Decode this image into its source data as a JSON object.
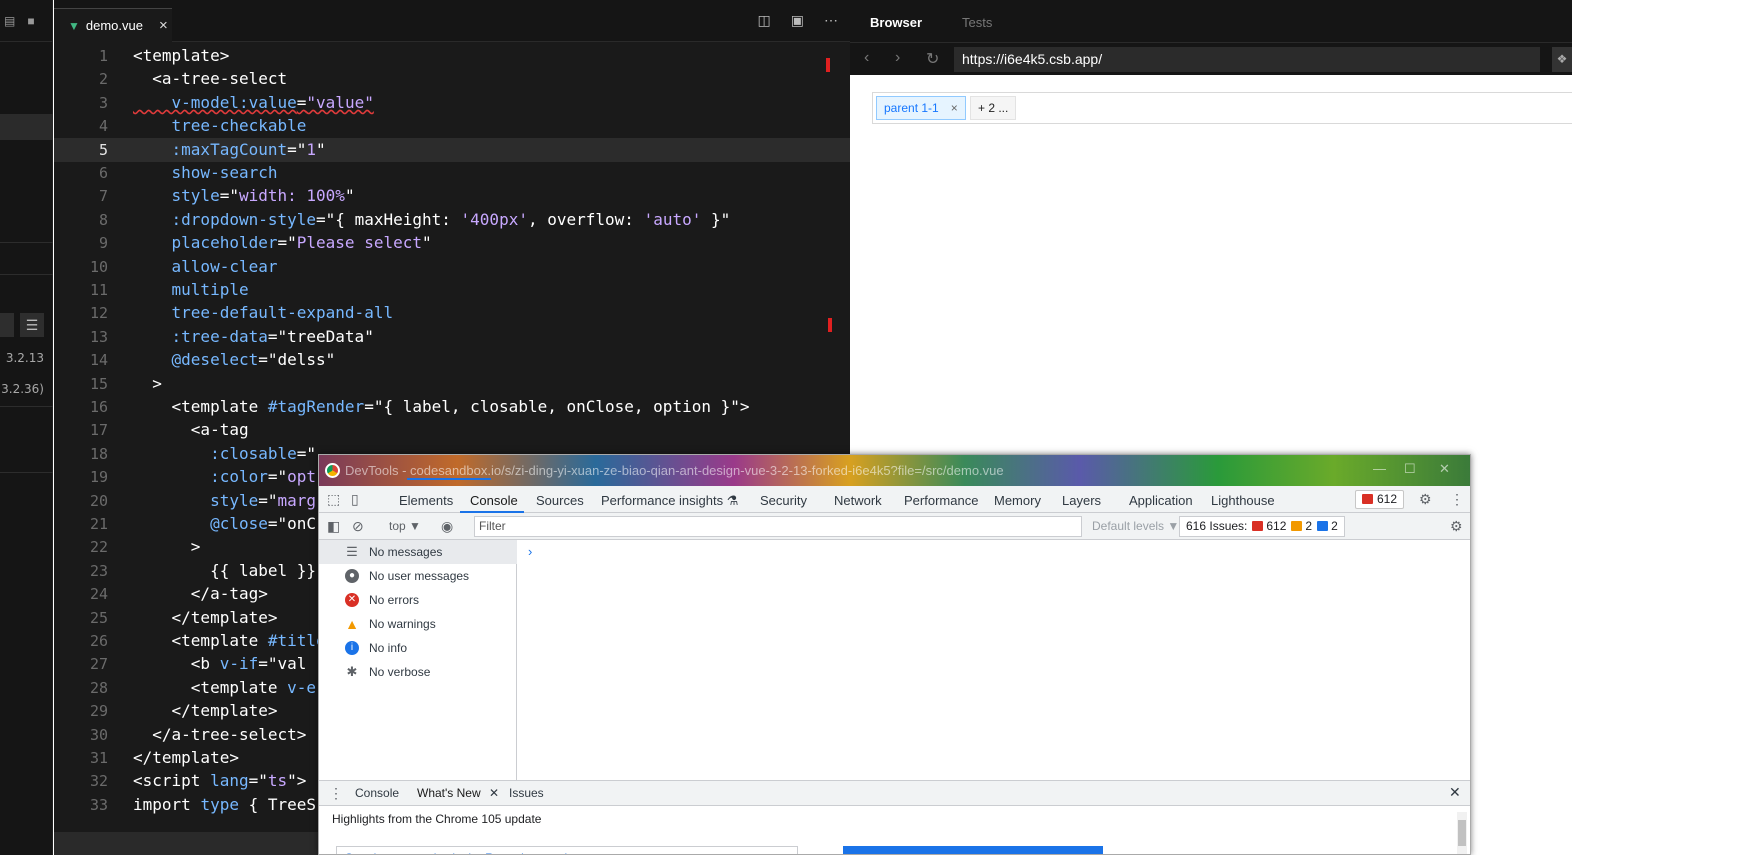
{
  "sidebar": {
    "versions": [
      "3.2.13",
      "3.2.36)"
    ]
  },
  "editor": {
    "tab_label": "demo.vue",
    "tab_close": "×",
    "lines": [
      [
        [
          "t-tag",
          "<template>"
        ]
      ],
      [
        [
          "t-tag",
          "  <a-tree-select"
        ]
      ],
      [
        [
          "t-attr t-err",
          "    v-model:value"
        ],
        [
          "t-tag t-err",
          "="
        ],
        [
          "t-str t-err",
          "\"value\""
        ]
      ],
      [
        [
          "t-attr",
          "    tree-checkable"
        ]
      ],
      [
        [
          "t-attr",
          "    :maxTagCount"
        ],
        [
          "t-tag",
          "=\""
        ],
        [
          "t-str",
          "1"
        ],
        [
          "t-tag",
          "\""
        ]
      ],
      [
        [
          "t-attr",
          "    show-search"
        ]
      ],
      [
        [
          "t-attr",
          "    style"
        ],
        [
          "t-tag",
          "=\""
        ],
        [
          "t-str",
          "width: 100%"
        ],
        [
          "t-tag",
          "\""
        ]
      ],
      [
        [
          "t-attr",
          "    :dropdown-style"
        ],
        [
          "t-tag",
          "=\"{ maxHeight: "
        ],
        [
          "t-str",
          "'400px'"
        ],
        [
          "t-tag",
          ", overflow: "
        ],
        [
          "t-str",
          "'auto'"
        ],
        [
          "t-tag",
          " }\""
        ]
      ],
      [
        [
          "t-attr",
          "    placeholder"
        ],
        [
          "t-tag",
          "=\""
        ],
        [
          "t-str",
          "Please select"
        ],
        [
          "t-tag",
          "\""
        ]
      ],
      [
        [
          "t-attr",
          "    allow-clear"
        ]
      ],
      [
        [
          "t-attr",
          "    multiple"
        ]
      ],
      [
        [
          "t-attr",
          "    tree-default-expand-all"
        ]
      ],
      [
        [
          "t-attr",
          "    :tree-data"
        ],
        [
          "t-tag",
          "=\"treeData\""
        ]
      ],
      [
        [
          "t-attr",
          "    @deselect"
        ],
        [
          "t-tag",
          "=\"delss\""
        ]
      ],
      [
        [
          "t-tag",
          "  >"
        ]
      ],
      [
        [
          "t-tag",
          "    <template "
        ],
        [
          "t-attr",
          "#tagRender"
        ],
        [
          "t-tag",
          "=\"{ label, closable, onClose, option }\">"
        ]
      ],
      [
        [
          "t-tag",
          "      <a-tag"
        ]
      ],
      [
        [
          "t-attr",
          "        :closable"
        ],
        [
          "t-tag",
          "=\""
        ]
      ],
      [
        [
          "t-attr",
          "        :color"
        ],
        [
          "t-tag",
          "=\""
        ],
        [
          "t-str",
          "opt"
        ]
      ],
      [
        [
          "t-attr",
          "        style"
        ],
        [
          "t-tag",
          "=\""
        ],
        [
          "t-str",
          "marg"
        ]
      ],
      [
        [
          "t-attr",
          "        @close"
        ],
        [
          "t-tag",
          "=\"onC"
        ]
      ],
      [
        [
          "t-tag",
          "      >"
        ]
      ],
      [
        [
          "t-tag",
          "        {{ label }}"
        ]
      ],
      [
        [
          "t-tag",
          "      </a-tag>"
        ]
      ],
      [
        [
          "t-tag",
          "    </template>"
        ]
      ],
      [
        [
          "t-tag",
          "    <template "
        ],
        [
          "t-attr",
          "#title"
        ]
      ],
      [
        [
          "t-tag",
          "      <b "
        ],
        [
          "t-attr",
          "v-if"
        ],
        [
          "t-tag",
          "=\"val "
        ]
      ],
      [
        [
          "t-tag",
          "      <template "
        ],
        [
          "t-attr",
          "v-e"
        ]
      ],
      [
        [
          "t-tag",
          "    </template>"
        ]
      ],
      [
        [
          "t-tag",
          "  </a-tree-select>"
        ]
      ],
      [
        [
          "t-tag",
          "</template>"
        ]
      ],
      [
        [
          "t-tag",
          "<script "
        ],
        [
          "t-attr",
          "lang"
        ],
        [
          "t-tag",
          "=\""
        ],
        [
          "t-str",
          "ts"
        ],
        [
          "t-tag",
          "\">"
        ]
      ],
      [
        [
          "t-tag",
          "import "
        ],
        [
          "t-attr",
          "type"
        ],
        [
          "t-tag",
          " { TreeS"
        ]
      ]
    ]
  },
  "browser": {
    "tabs": [
      "Browser",
      "Tests"
    ],
    "url": "https://i6e4k5.csb.app/",
    "tag_selected": "parent 1-1",
    "tag_close": "×",
    "tag_more": "+ 2 ..."
  },
  "devtools": {
    "window_title": "DevTools - codesandbox.io/s/zi-ding-yi-xuan-ze-biao-qian-ant-design-vue-3-2-13-forked-i6e4k5?file=/src/demo.vue",
    "tabs": [
      "Elements",
      "Console",
      "Sources",
      "Performance insights ⚗",
      "Security",
      "Network",
      "Performance",
      "Memory",
      "Layers",
      "Application",
      "Lighthouse"
    ],
    "error_badge": "612",
    "context": "top ▼",
    "filter_placeholder": "Filter",
    "default_levels": "Default levels ▼",
    "issues_label": "616 Issues:",
    "issues_counts": [
      "612",
      "2",
      "2"
    ],
    "sidebar_items": [
      "No messages",
      "No user messages",
      "No errors",
      "No warnings",
      "No info",
      "No verbose"
    ],
    "prompt": "›",
    "drawer_tabs": [
      "Console",
      "What's New",
      "Issues"
    ],
    "drawer_title": "Highlights from the Chrome 105 update",
    "drawer_card_text": "Step-by-step replay in the Recorder panel"
  }
}
